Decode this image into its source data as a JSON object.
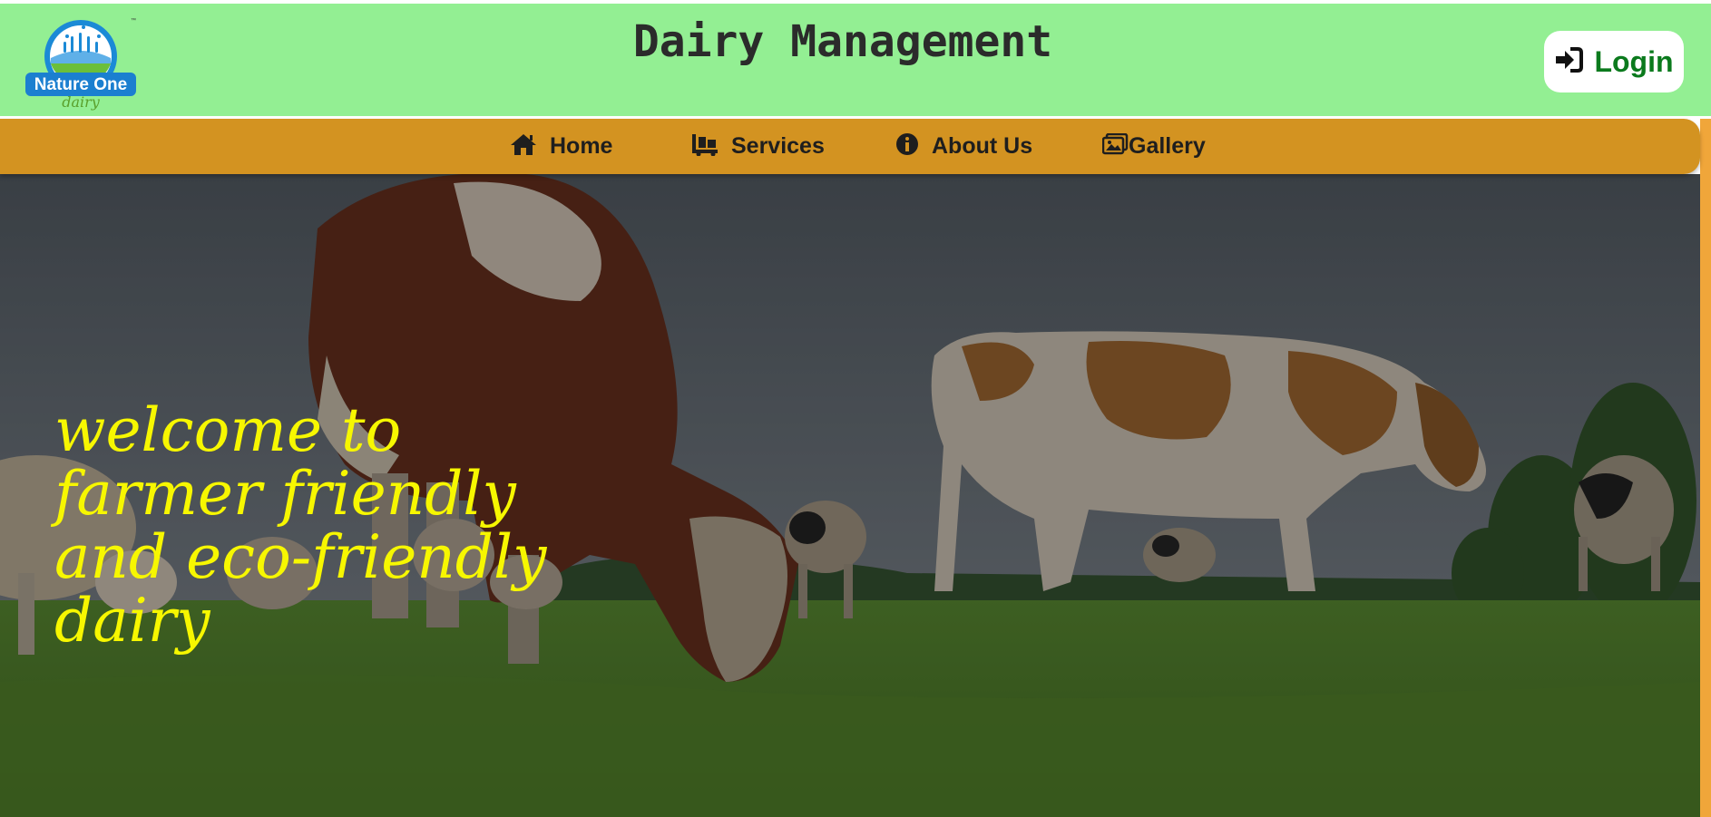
{
  "header": {
    "title": "Dairy Management",
    "logo": {
      "icon": "nature-one-dairy-logo",
      "brand": "Nature One",
      "sub": "dairy",
      "trademark": "™"
    },
    "login_label": "Login",
    "login_icon": "sign-in-icon"
  },
  "nav": {
    "items": [
      {
        "label": "Home",
        "icon": "home-icon"
      },
      {
        "label": "Services",
        "icon": "dolly-icon"
      },
      {
        "label": "About Us",
        "icon": "info-circle-icon"
      },
      {
        "label": "Gallery",
        "icon": "images-icon"
      }
    ]
  },
  "hero": {
    "headline": "welcome to farmer friendly and eco-friendly dairy",
    "image": "cows-grazing-on-pasture"
  },
  "colors": {
    "header_bg": "#93ef93",
    "nav_bg": "#d39321",
    "accent_bar": "#f0a63a",
    "headline": "#f7f700",
    "login_text": "#0b7a1d"
  }
}
